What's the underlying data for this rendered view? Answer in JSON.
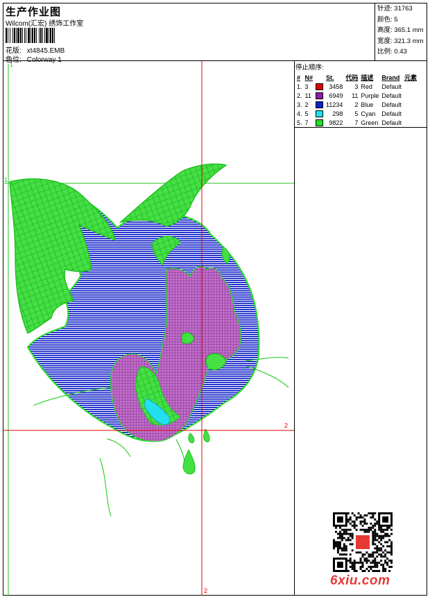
{
  "header": {
    "title": "生产作业图",
    "subtitle": "Wilcom(汇宏) 绣饰工作室",
    "file_label": "花版:",
    "file_value": "xt4845.EMB",
    "colorway_label": "色位:",
    "colorway_value": "Colorway 1"
  },
  "stats": [
    {
      "label": "针迹:",
      "value": "31763"
    },
    {
      "label": "颜色:",
      "value": "5"
    },
    {
      "label": "高度:",
      "value": "365.1 mm"
    },
    {
      "label": "宽度:",
      "value": "321.3 mm"
    },
    {
      "label": "比例:",
      "value": "0.43"
    }
  ],
  "stop_sequence": {
    "title": "停止顺序:",
    "headers": [
      "#",
      "N#",
      "St.",
      "代码",
      "描述",
      "Brand",
      "元素"
    ],
    "rows": [
      {
        "idx": "1.",
        "n": "3",
        "color": "#e00000",
        "stitches": "3458",
        "code": "3",
        "desc": "Red",
        "brand": "Default"
      },
      {
        "idx": "2.",
        "n": "11",
        "color": "#8e1fa8",
        "stitches": "6949",
        "code": "11",
        "desc": "Purple",
        "brand": "Default"
      },
      {
        "idx": "3.",
        "n": "2",
        "color": "#1222c8",
        "stitches": "11234",
        "code": "2",
        "desc": "Blue",
        "brand": "Default"
      },
      {
        "idx": "4.",
        "n": "5",
        "color": "#1fe0f0",
        "stitches": "298",
        "code": "5",
        "desc": "Cyan",
        "brand": "Default"
      },
      {
        "idx": "5.",
        "n": "7",
        "color": "#22e022",
        "stitches": "9822",
        "code": "7",
        "desc": "Green",
        "brand": "Default"
      }
    ]
  },
  "markers": {
    "one_top": "1",
    "one_left": "1",
    "two_right": "2",
    "two_bottom": "2"
  },
  "watermark": "6xiu.com",
  "seal_text": "以图绣版",
  "colors": {
    "guide_red": "#e00000",
    "guide_green": "#22c022",
    "blue": "#1222c8",
    "green": "#33e033",
    "purple": "#a040b0",
    "cyan": "#22e0f0"
  }
}
